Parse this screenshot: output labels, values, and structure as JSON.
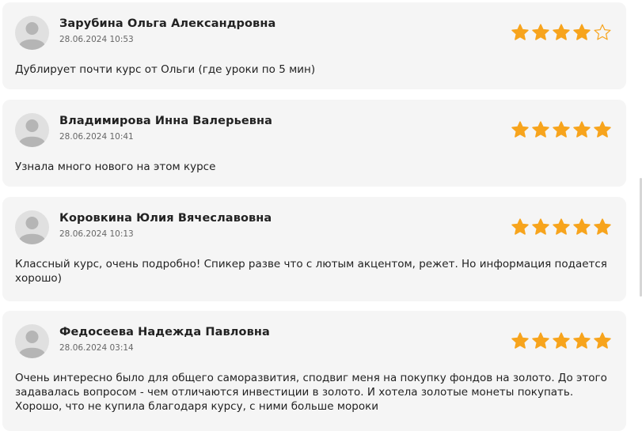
{
  "colors": {
    "card_background": "#f5f5f5",
    "star_filled": "#f7a41d",
    "star_empty_outline": "#f7a41d",
    "text": "#222222",
    "date": "#666666"
  },
  "star_icon": "star-icon",
  "avatar_icon": "user-placeholder-icon",
  "reviews": [
    {
      "author": "Зарубина Ольга Александровна",
      "date": "28.06.2024 10:53",
      "rating": 4,
      "max_rating": 5,
      "text": "Дублирует почти курс от Ольги (где уроки по 5 мин)"
    },
    {
      "author": "Владимирова Инна Валерьевна",
      "date": "28.06.2024 10:41",
      "rating": 5,
      "max_rating": 5,
      "text": "Узнала много нового на этом курсе"
    },
    {
      "author": "Коровкина Юлия Вячеславовна",
      "date": "28.06.2024 10:13",
      "rating": 5,
      "max_rating": 5,
      "text": "Классный курс, очень подробно! Спикер разве что с лютым акцентом, режет. Но информация подается хорошо)"
    },
    {
      "author": "Федосеева Надежда Павловна",
      "date": "28.06.2024 03:14",
      "rating": 5,
      "max_rating": 5,
      "text": "Очень интересно было для общего саморазвития, сподвиг меня на покупку фондов на золото. До этого задавалась вопросом - чем отличаются инвестиции в золото. И хотела золотые монеты покупать. Хорошо, что не купила благодаря курсу, с ними больше мороки"
    }
  ]
}
